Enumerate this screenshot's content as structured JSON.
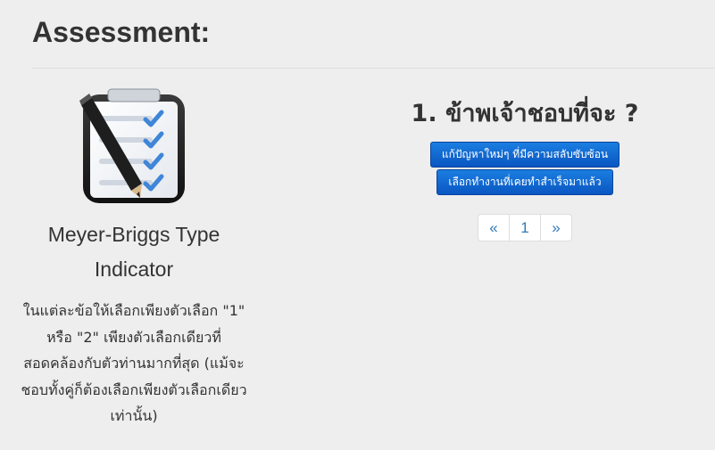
{
  "page": {
    "title": "Assessment:"
  },
  "test": {
    "icon": "checklist-clipboard-icon",
    "name": "Meyer-Briggs Type Indicator",
    "instructions": "ในแต่ละข้อให้เลือกเพียงตัวเลือก \"1\" หรือ \"2\" เพียงตัวเลือกเดียวที่สอดคล้องกับตัวท่านมากที่สุด (แม้จะชอบทั้งคู่ก็ต้องเลือกเพียงตัวเลือกเดียวเท่านั้น)"
  },
  "question": {
    "text": "1. ข้าพเจ้าชอบที่จะ ?",
    "answers": [
      "แก้ปัญหาใหม่ๆ ที่มีความสลับซับซ้อน",
      "เลือกทำงานที่เคยทำสำเร็จมาแล้ว"
    ]
  },
  "pagination": {
    "prev": "«",
    "current": "1",
    "next": "»"
  },
  "colors": {
    "button": "#0a5fcf",
    "link": "#337ab7",
    "background": "#eeeeee"
  }
}
